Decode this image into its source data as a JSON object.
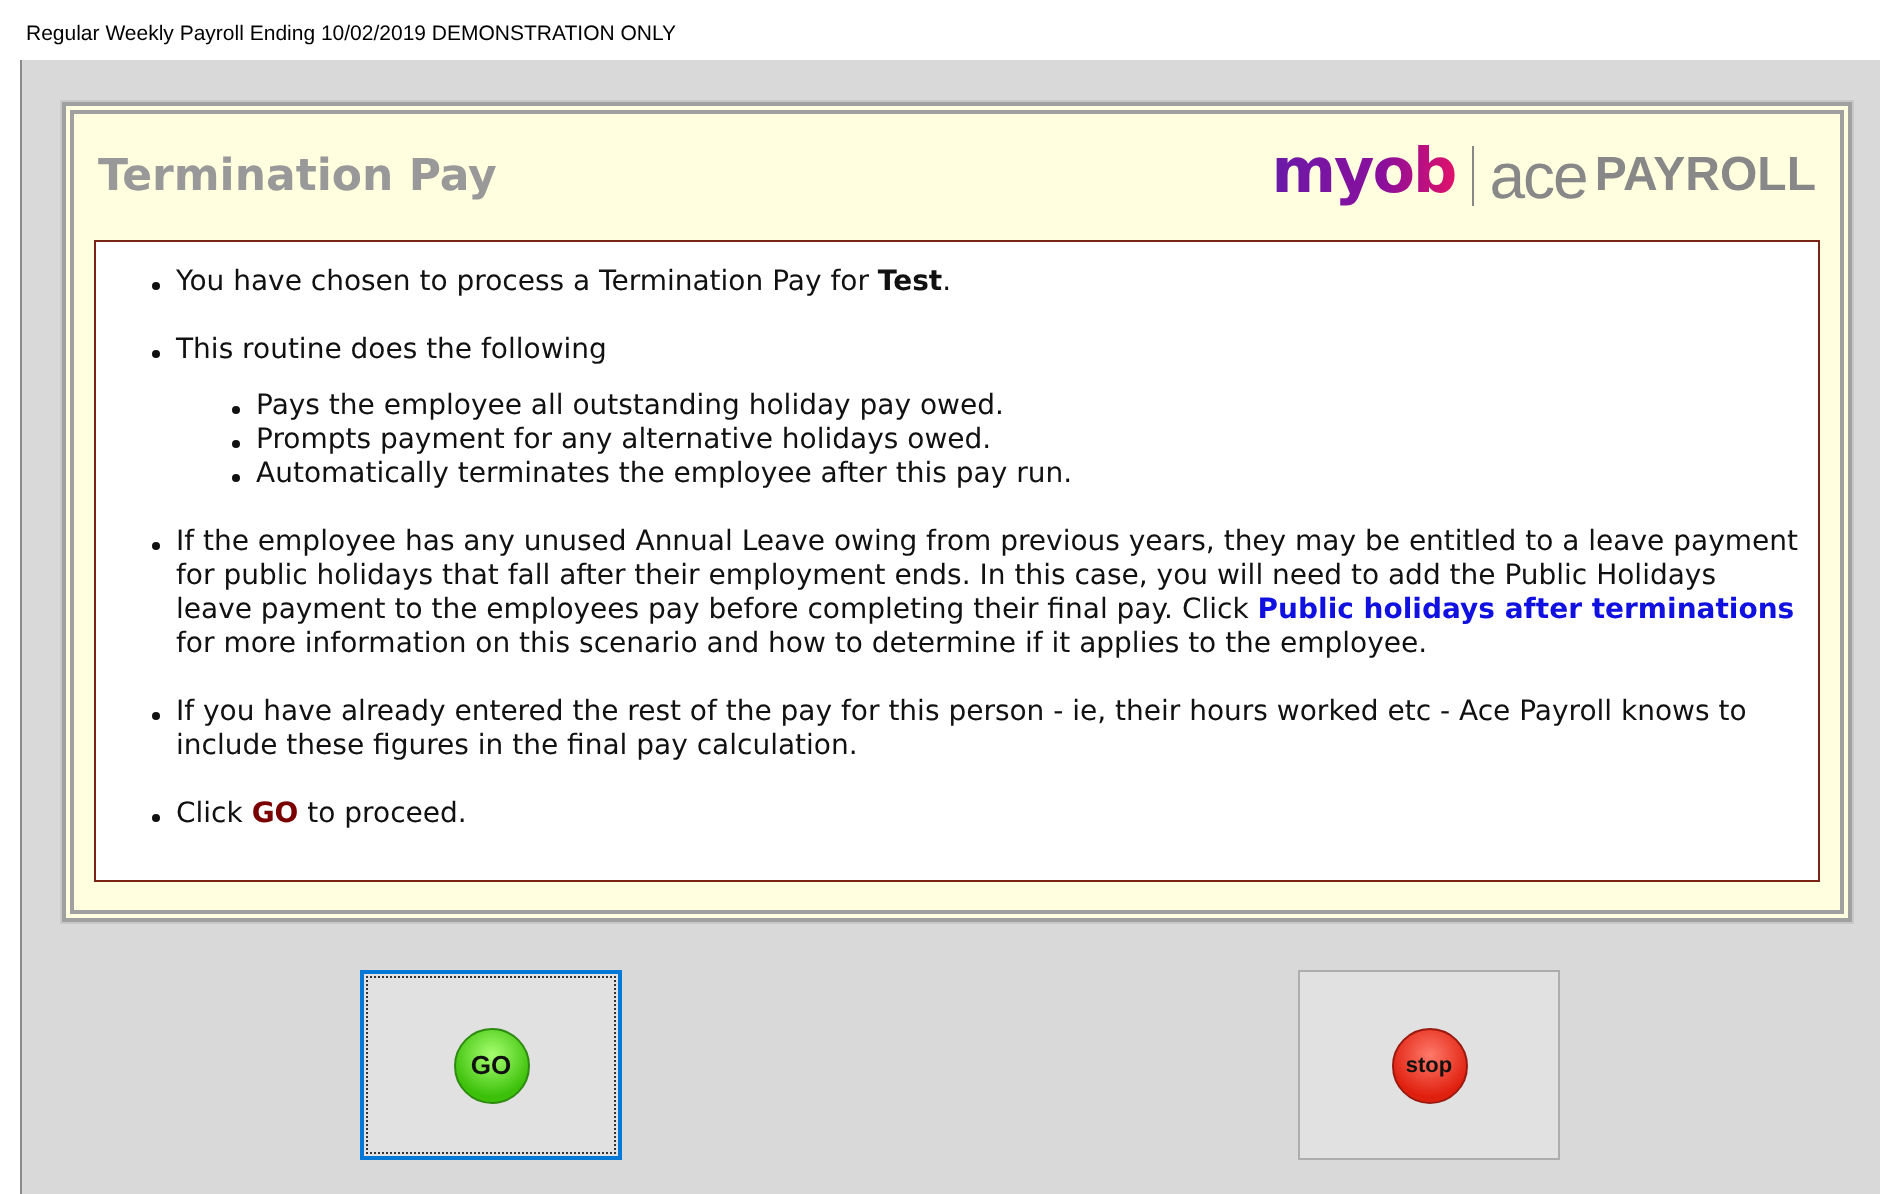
{
  "window": {
    "title": "Regular Weekly Payroll Ending 10/02/2019 DEMONSTRATION ONLY"
  },
  "panel": {
    "title": "Termination Pay",
    "logo": {
      "brand": "myob",
      "product": "ace",
      "suffix": "PAYROLL"
    }
  },
  "bullets": [
    {
      "parts": [
        {
          "kind": "plain",
          "text": "You have chosen to process a Termination Pay for "
        },
        {
          "kind": "bold",
          "text": "Test"
        },
        {
          "kind": "plain",
          "text": "."
        }
      ]
    },
    {
      "parts": [
        {
          "kind": "plain",
          "text": "This routine does the following"
        }
      ],
      "children": [
        "Pays the employee all outstanding holiday pay owed.",
        "Prompts payment for any alternative holidays owed.",
        "Automatically terminates the employee after this pay run."
      ]
    },
    {
      "parts": [
        {
          "kind": "plain",
          "text": "If the employee has any unused Annual Leave owing from previous years, they may be entitled to a leave payment for public holidays that fall after their employment ends. In this case, you will need to add the Public Holidays leave payment to the employees pay before completing their final pay.  Click "
        },
        {
          "kind": "link",
          "text": "Public holidays after terminations"
        },
        {
          "kind": "plain",
          "text": " for more information on this scenario and how to determine if it applies to the employee."
        }
      ]
    },
    {
      "parts": [
        {
          "kind": "plain",
          "text": "If you have already entered the rest of the pay for this person - ie, their hours worked etc - Ace Payroll knows to include these figures in the final pay calculation."
        }
      ]
    },
    {
      "parts": [
        {
          "kind": "plain",
          "text": "Click "
        },
        {
          "kind": "keyword",
          "text": "GO"
        },
        {
          "kind": "plain",
          "text": " to proceed."
        }
      ]
    }
  ],
  "buttons": [
    {
      "kind": "go",
      "label": "GO",
      "focused": true
    },
    {
      "kind": "stop",
      "label": "stop",
      "focused": false
    }
  ]
}
